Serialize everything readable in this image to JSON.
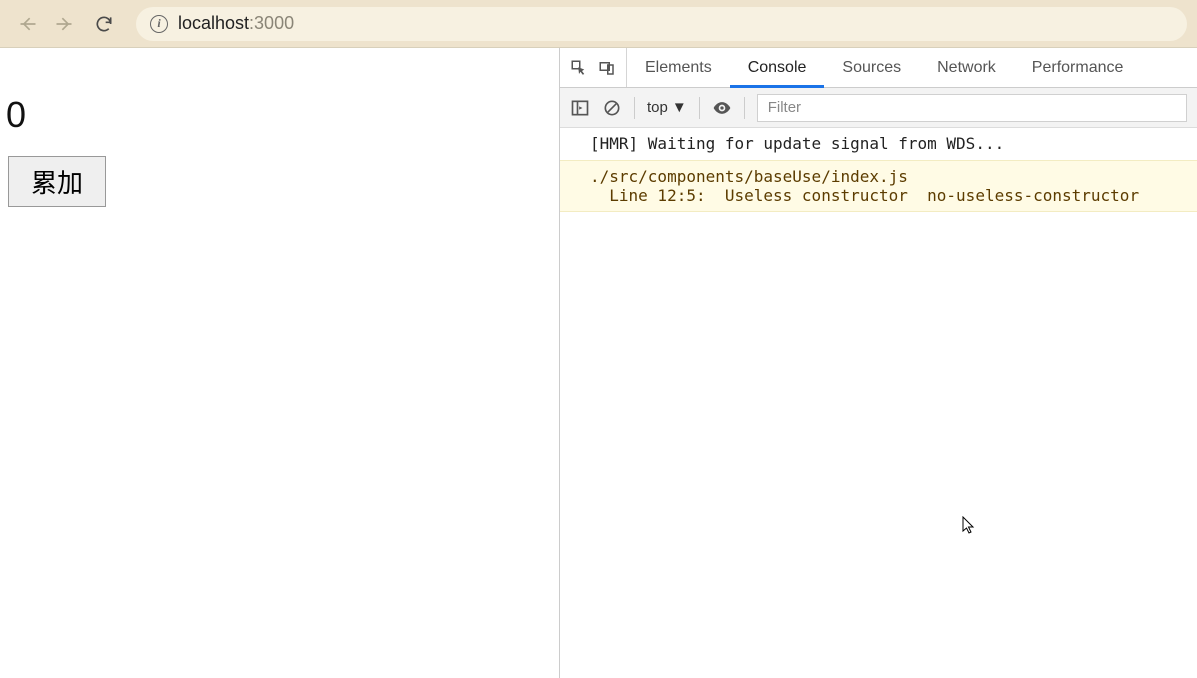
{
  "browser": {
    "url_host": "localhost",
    "url_port": ":3000"
  },
  "page": {
    "counter_value": "0",
    "button_label": "累加"
  },
  "devtools": {
    "tabs": {
      "elements": "Elements",
      "console": "Console",
      "sources": "Sources",
      "network": "Network",
      "performance": "Performance"
    },
    "toolbar": {
      "context": "top",
      "filter_placeholder": "Filter"
    },
    "logs": {
      "hmr": "[HMR] Waiting for update signal from WDS...",
      "warn_path": "./src/components/baseUse/index.js",
      "warn_detail": "  Line 12:5:  Useless constructor  no-useless-constructor"
    }
  }
}
